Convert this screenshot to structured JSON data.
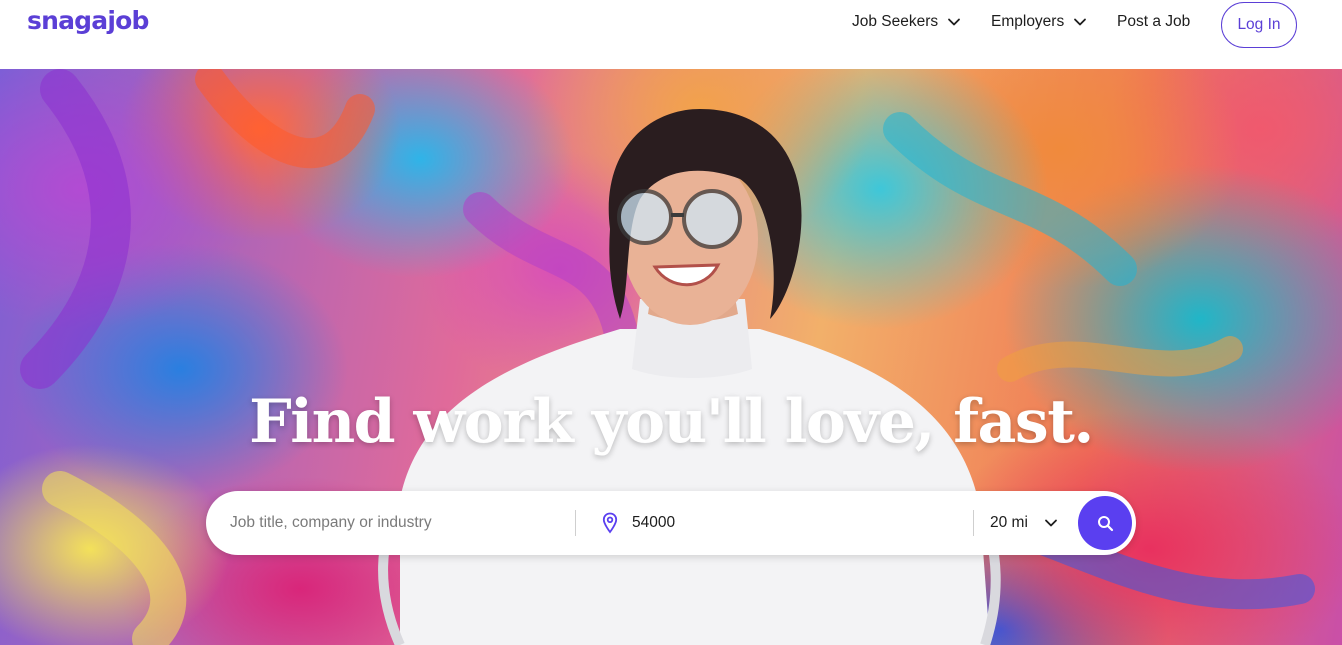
{
  "header": {
    "logo_text": "snagajob",
    "nav": {
      "job_seekers": "Job Seekers",
      "employers": "Employers",
      "post_job": "Post a Job"
    },
    "login_label": "Log In"
  },
  "hero": {
    "title": "Find work you'll love, fast."
  },
  "search": {
    "keyword_placeholder": "Job title, company or industry",
    "keyword_value": "",
    "location_value": "54000",
    "radius_value": "20 mi",
    "button_icon": "search-icon"
  },
  "colors": {
    "brand_purple": "#5b3fd6",
    "search_button": "#5a3ff0",
    "text_dark": "#1d1d1d",
    "placeholder_gray": "#7a7a7a"
  }
}
